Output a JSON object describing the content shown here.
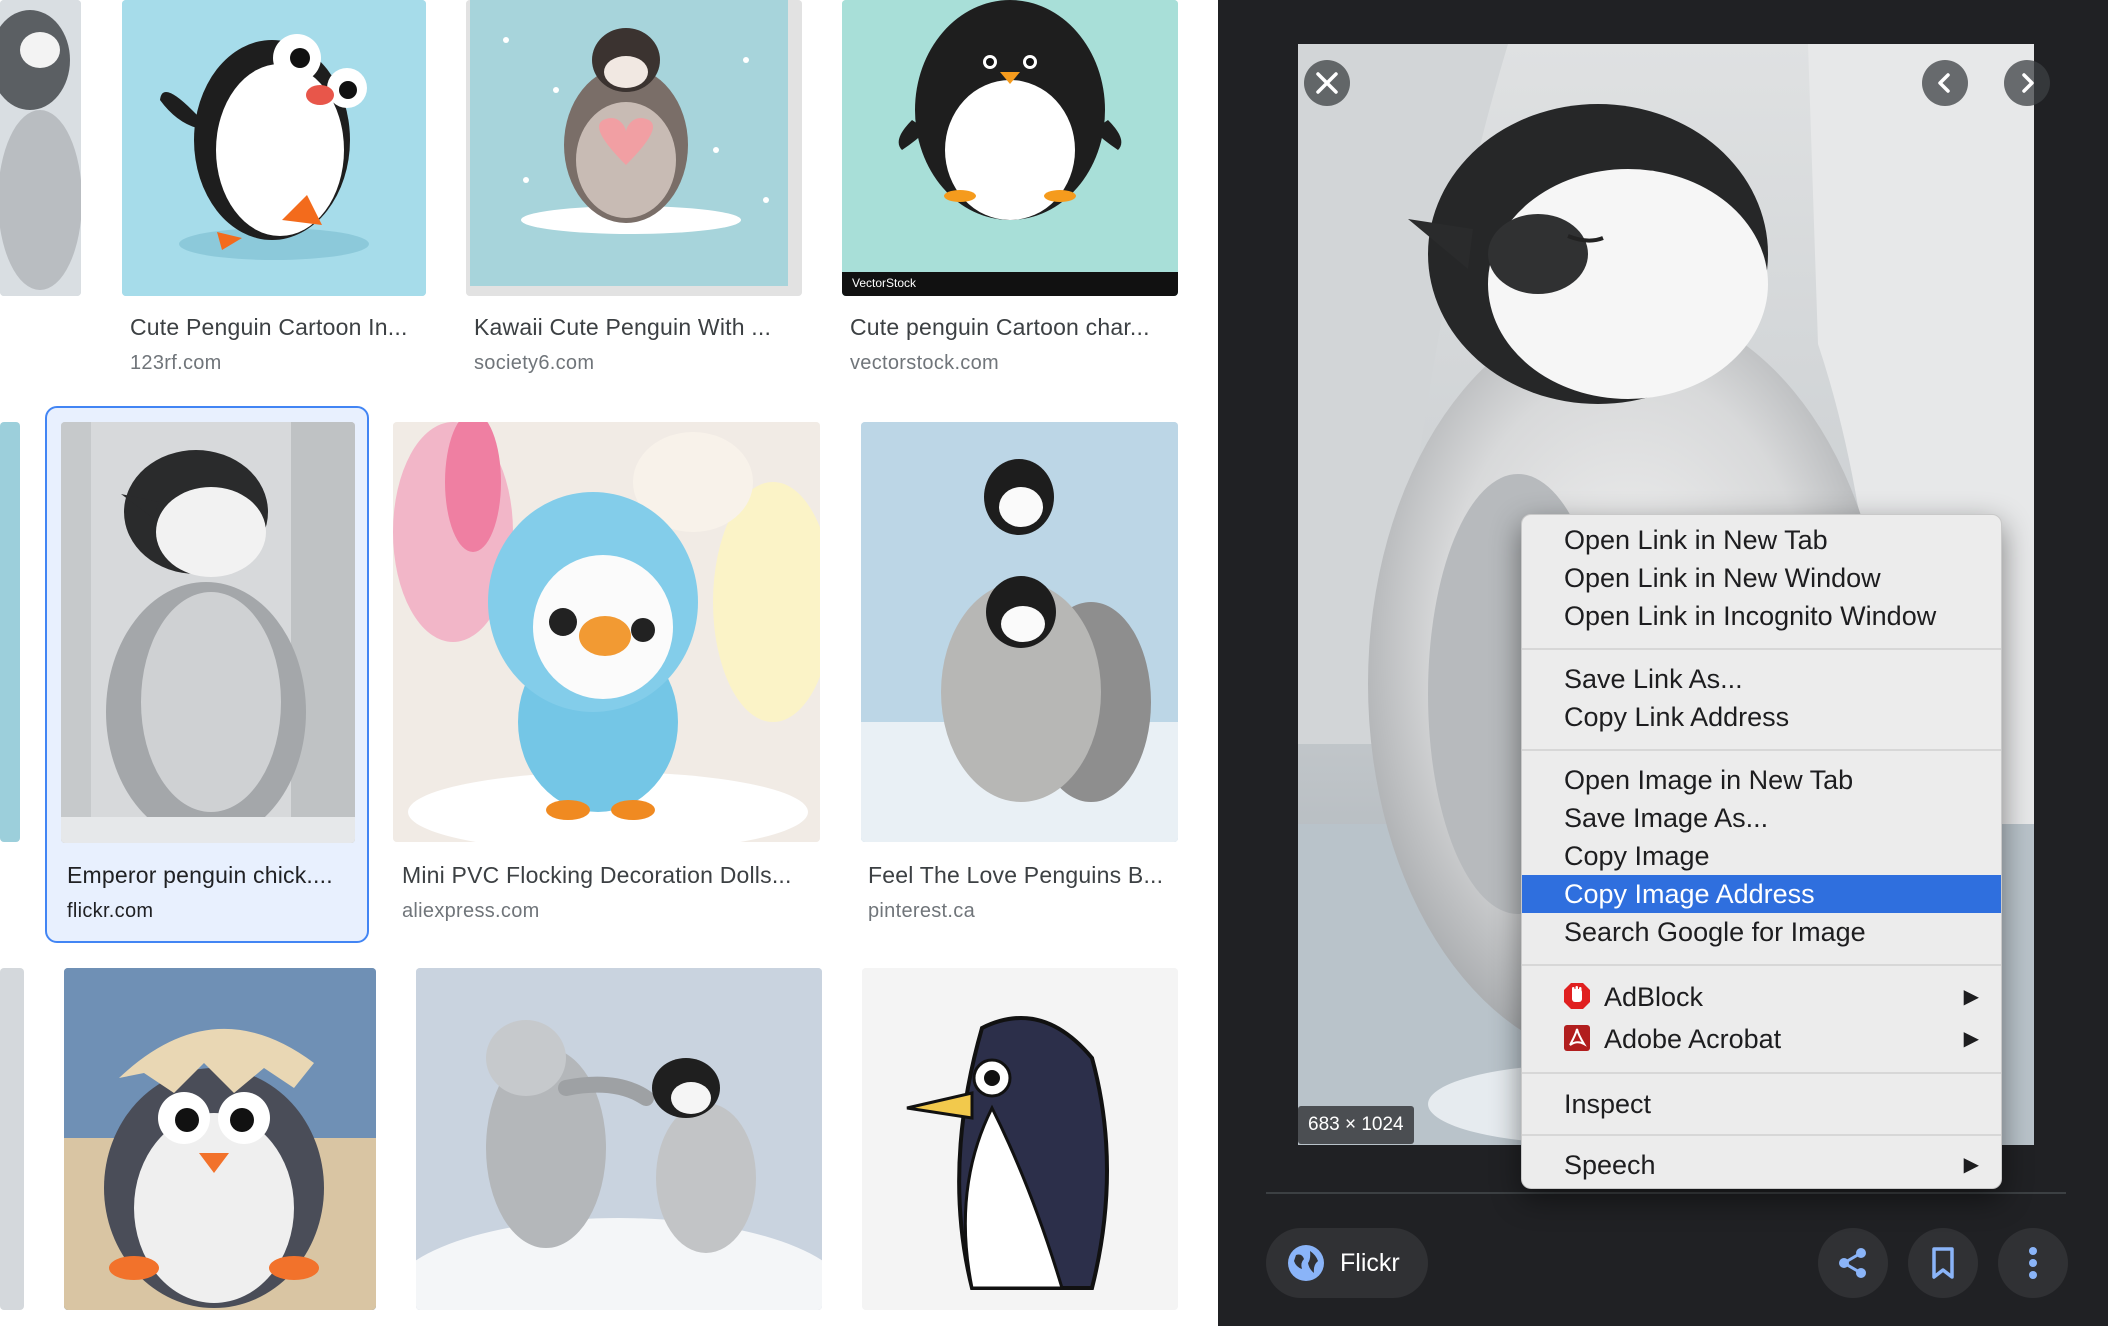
{
  "results": [
    {
      "caption": "Cute Penguin Cartoon In...",
      "source": "123rf.com"
    },
    {
      "caption": "Kawaii Cute Penguin With ...",
      "source": "society6.com"
    },
    {
      "caption": "Cute penguin Cartoon char...",
      "source": "vectorstock.com",
      "watermark": "VectorStock"
    },
    {
      "caption": "Emperor penguin chick....",
      "source": "flickr.com"
    },
    {
      "caption": "Mini PVC Flocking Decoration Dolls...",
      "source": "aliexpress.com"
    },
    {
      "caption": "Feel The Love Penguins B...",
      "source": "pinterest.ca"
    }
  ],
  "preview": {
    "dimensions": "683 × 1024",
    "source_label": "Flickr"
  },
  "context_menu": {
    "items": [
      "Open Link in New Tab",
      "Open Link in New Window",
      "Open Link in Incognito Window",
      "Save Link As...",
      "Copy Link Address",
      "Open Image in New Tab",
      "Save Image As...",
      "Copy Image",
      "Copy Image Address",
      "Search Google for Image",
      "AdBlock",
      "Adobe Acrobat",
      "Inspect",
      "Speech"
    ],
    "highlighted": "Copy Image Address"
  },
  "icons": [
    "close-icon",
    "chevron-left-icon",
    "chevron-right-icon",
    "globe-icon",
    "share-icon",
    "bookmark-icon",
    "more-vert-icon",
    "adblock-icon",
    "acrobat-icon",
    "submenu-arrow-icon"
  ],
  "colors": {
    "highlight": "#2f6fde",
    "selected_border": "#4285f4",
    "panel_bg": "#202124"
  }
}
